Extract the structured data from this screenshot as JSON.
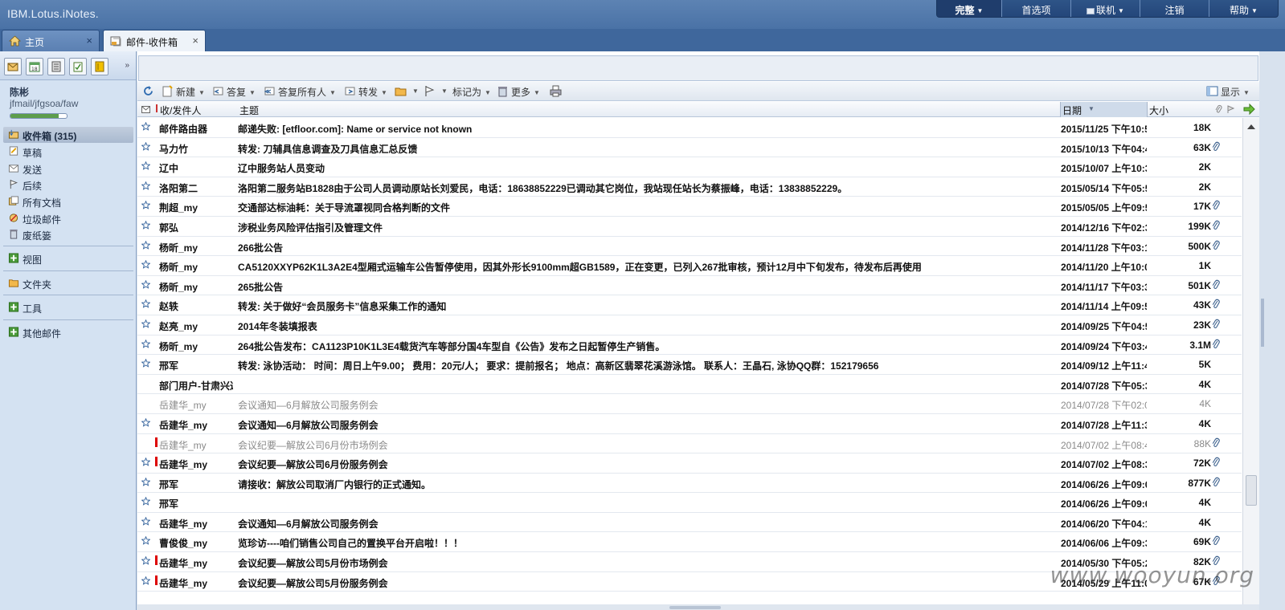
{
  "app": {
    "brand": "IBM.Lotus.iNotes."
  },
  "topnav": [
    {
      "label": "完整",
      "caret": true,
      "w": 80
    },
    {
      "label": "首选项",
      "caret": false,
      "w": 86
    },
    {
      "label": "联机",
      "caret": true,
      "w": 86,
      "icon": "computer-icon"
    },
    {
      "label": "注销",
      "caret": false,
      "w": 86
    },
    {
      "label": "帮助",
      "caret": true,
      "w": 86
    }
  ],
  "tabs": {
    "home": "主页",
    "inbox": "邮件-收件箱",
    "close": "×"
  },
  "user": {
    "name": "陈彬",
    "id": "jfmail/jfgsoa/faw",
    "quota_fraction": 0.85
  },
  "nav": [
    {
      "label": "收件箱 (315)",
      "icon": "inbox-icon",
      "sel": true
    },
    {
      "label": "草稿",
      "icon": "drafts-icon"
    },
    {
      "label": "发送",
      "icon": "sent-icon"
    },
    {
      "label": "后续",
      "icon": "follow-up-icon"
    },
    {
      "label": "所有文档",
      "icon": "all-documents-icon"
    },
    {
      "label": "垃圾邮件",
      "icon": "junk-icon"
    },
    {
      "label": "废纸篓",
      "icon": "trash-icon"
    },
    {
      "label": "视图",
      "icon": "expand-icon"
    },
    {
      "label": "文件夹",
      "icon": "folder-icon"
    },
    {
      "label": "工具",
      "icon": "expand-icon"
    },
    {
      "label": "其他邮件",
      "icon": "expand-icon"
    }
  ],
  "toolbar": {
    "new": "新建",
    "reply": "答复",
    "reply_all": "答复所有人",
    "forward": "转发",
    "mark_as": "标记为",
    "more": "更多",
    "display": "显示"
  },
  "columns": {
    "from": "收/发件人",
    "subject": "主题",
    "date": "日期",
    "size": "大小"
  },
  "messages": [
    {
      "from": "邮件路由器",
      "subject": "邮递失败: [etfloor.com]: Name or service not known",
      "date": "2015/11/25 下午10:5",
      "size": "18K",
      "star": true,
      "unread": true,
      "clip": false,
      "imp": false
    },
    {
      "from": "马力竹",
      "subject": "转发: 刀辅具信息调查及刀具信息汇总反馈",
      "date": "2015/10/13 下午04:4",
      "size": "63K",
      "star": true,
      "unread": true,
      "clip": true,
      "imp": false
    },
    {
      "from": "辽中",
      "subject": "辽中服务站人员变动",
      "date": "2015/10/07 上午10:3",
      "size": "2K",
      "star": true,
      "unread": true,
      "clip": false,
      "imp": false
    },
    {
      "from": "洛阳第二",
      "subject": "洛阳第二服务站B1828由于公司人员调动原站长刘爱民，电话：18638852229已调动其它岗位，我站现任站长为蔡振峰，电话：13838852229。",
      "date": "2015/05/14 下午05:5",
      "size": "2K",
      "star": true,
      "unread": true,
      "clip": false,
      "imp": false
    },
    {
      "from": "荆超_my",
      "subject": "交通部达标油耗：关于导流罩视同合格判断的文件",
      "date": "2015/05/05 上午09:5",
      "size": "17K",
      "star": true,
      "unread": true,
      "clip": true,
      "imp": false
    },
    {
      "from": "郭弘",
      "subject": "涉税业务风险评估指引及管理文件",
      "date": "2014/12/16 下午02:3",
      "size": "199K",
      "star": true,
      "unread": true,
      "clip": true,
      "imp": false
    },
    {
      "from": "杨昕_my",
      "subject": "266批公告",
      "date": "2014/11/28 下午03:1",
      "size": "500K",
      "star": true,
      "unread": true,
      "clip": true,
      "imp": false
    },
    {
      "from": "杨昕_my",
      "subject": "CA5120XXYP62K1L3A2E4型厢式运输车公告暂停使用，因其外形长9100mm超GB1589，正在变更，已列入267批审核，预计12月中下旬发布，待发布后再使用",
      "date": "2014/11/20 上午10:0",
      "size": "1K",
      "star": true,
      "unread": true,
      "clip": false,
      "imp": false
    },
    {
      "from": "杨昕_my",
      "subject": "265批公告",
      "date": "2014/11/17 下午03:3",
      "size": "501K",
      "star": true,
      "unread": true,
      "clip": true,
      "imp": false
    },
    {
      "from": "赵轶",
      "subject": "转发: 关于做好“会员服务卡”信息采集工作的通知",
      "date": "2014/11/14 上午09:5",
      "size": "43K",
      "star": true,
      "unread": true,
      "clip": true,
      "imp": false
    },
    {
      "from": "赵亮_my",
      "subject": "2014年冬装填报表",
      "date": "2014/09/25 下午04:5",
      "size": "23K",
      "star": true,
      "unread": true,
      "clip": true,
      "imp": false
    },
    {
      "from": "杨昕_my",
      "subject": "264批公告发布：CA1123P10K1L3E4载货汽车等部分国4车型自《公告》发布之日起暂停生产销售。",
      "date": "2014/09/24 下午03:4",
      "size": "3.1M",
      "star": true,
      "unread": true,
      "clip": true,
      "imp": false
    },
    {
      "from": "邢军",
      "subject": "转发: 泳协活动： 时间：周日上午9.00； 费用：20元/人； 要求：提前报名； 地点：高新区翡翠花溪游泳馆。 联系人：王晶石, 泳协QQ群：152179656",
      "date": "2014/09/12 上午11:4",
      "size": "5K",
      "star": true,
      "unread": true,
      "clip": false,
      "imp": false
    },
    {
      "from": "部门用户-甘肃兴达",
      "subject": "",
      "date": "2014/07/28 下午05:3",
      "size": "4K",
      "star": false,
      "unread": true,
      "clip": false,
      "imp": false
    },
    {
      "from": "岳建华_my",
      "subject": "会议通知—6月解放公司服务例会",
      "date": "2014/07/28 下午02:0",
      "size": "4K",
      "star": false,
      "unread": false,
      "clip": false,
      "imp": false
    },
    {
      "from": "岳建华_my",
      "subject": "会议通知—6月解放公司服务例会",
      "date": "2014/07/28 上午11:3",
      "size": "4K",
      "star": true,
      "unread": true,
      "clip": false,
      "imp": false
    },
    {
      "from": "岳建华_my",
      "subject": "会议纪要—解放公司6月份市场例会",
      "date": "2014/07/02 上午08:4",
      "size": "88K",
      "star": false,
      "unread": false,
      "clip": true,
      "imp": true
    },
    {
      "from": "岳建华_my",
      "subject": "会议纪要—解放公司6月份服务例会",
      "date": "2014/07/02 上午08:3",
      "size": "72K",
      "star": true,
      "unread": true,
      "clip": true,
      "imp": true
    },
    {
      "from": "邢军",
      "subject": "请接收：解放公司取消厂内银行的正式通知。",
      "date": "2014/06/26 上午09:0",
      "size": "877K",
      "star": true,
      "unread": true,
      "clip": true,
      "imp": false
    },
    {
      "from": "邢军",
      "subject": "",
      "date": "2014/06/26 上午09:0",
      "size": "4K",
      "star": true,
      "unread": true,
      "clip": false,
      "imp": false
    },
    {
      "from": "岳建华_my",
      "subject": "会议通知—6月解放公司服务例会",
      "date": "2014/06/20 下午04:1",
      "size": "4K",
      "star": true,
      "unread": true,
      "clip": false,
      "imp": false
    },
    {
      "from": "曹俊俊_my",
      "subject": "览珍访----咱们销售公司自己的置换平台开启啦！！！",
      "date": "2014/06/06 上午09:3",
      "size": "69K",
      "star": true,
      "unread": true,
      "clip": true,
      "imp": false
    },
    {
      "from": "岳建华_my",
      "subject": "会议纪要—解放公司5月份市场例会",
      "date": "2014/05/30 下午05:2",
      "size": "82K",
      "star": true,
      "unread": true,
      "clip": true,
      "imp": true
    },
    {
      "from": "岳建华_my",
      "subject": "会议纪要—解放公司5月份服务例会",
      "date": "2014/05/29 上午11:0",
      "size": "67K",
      "star": true,
      "unread": true,
      "clip": true,
      "imp": true
    }
  ],
  "watermark": "www.wooyun.org"
}
